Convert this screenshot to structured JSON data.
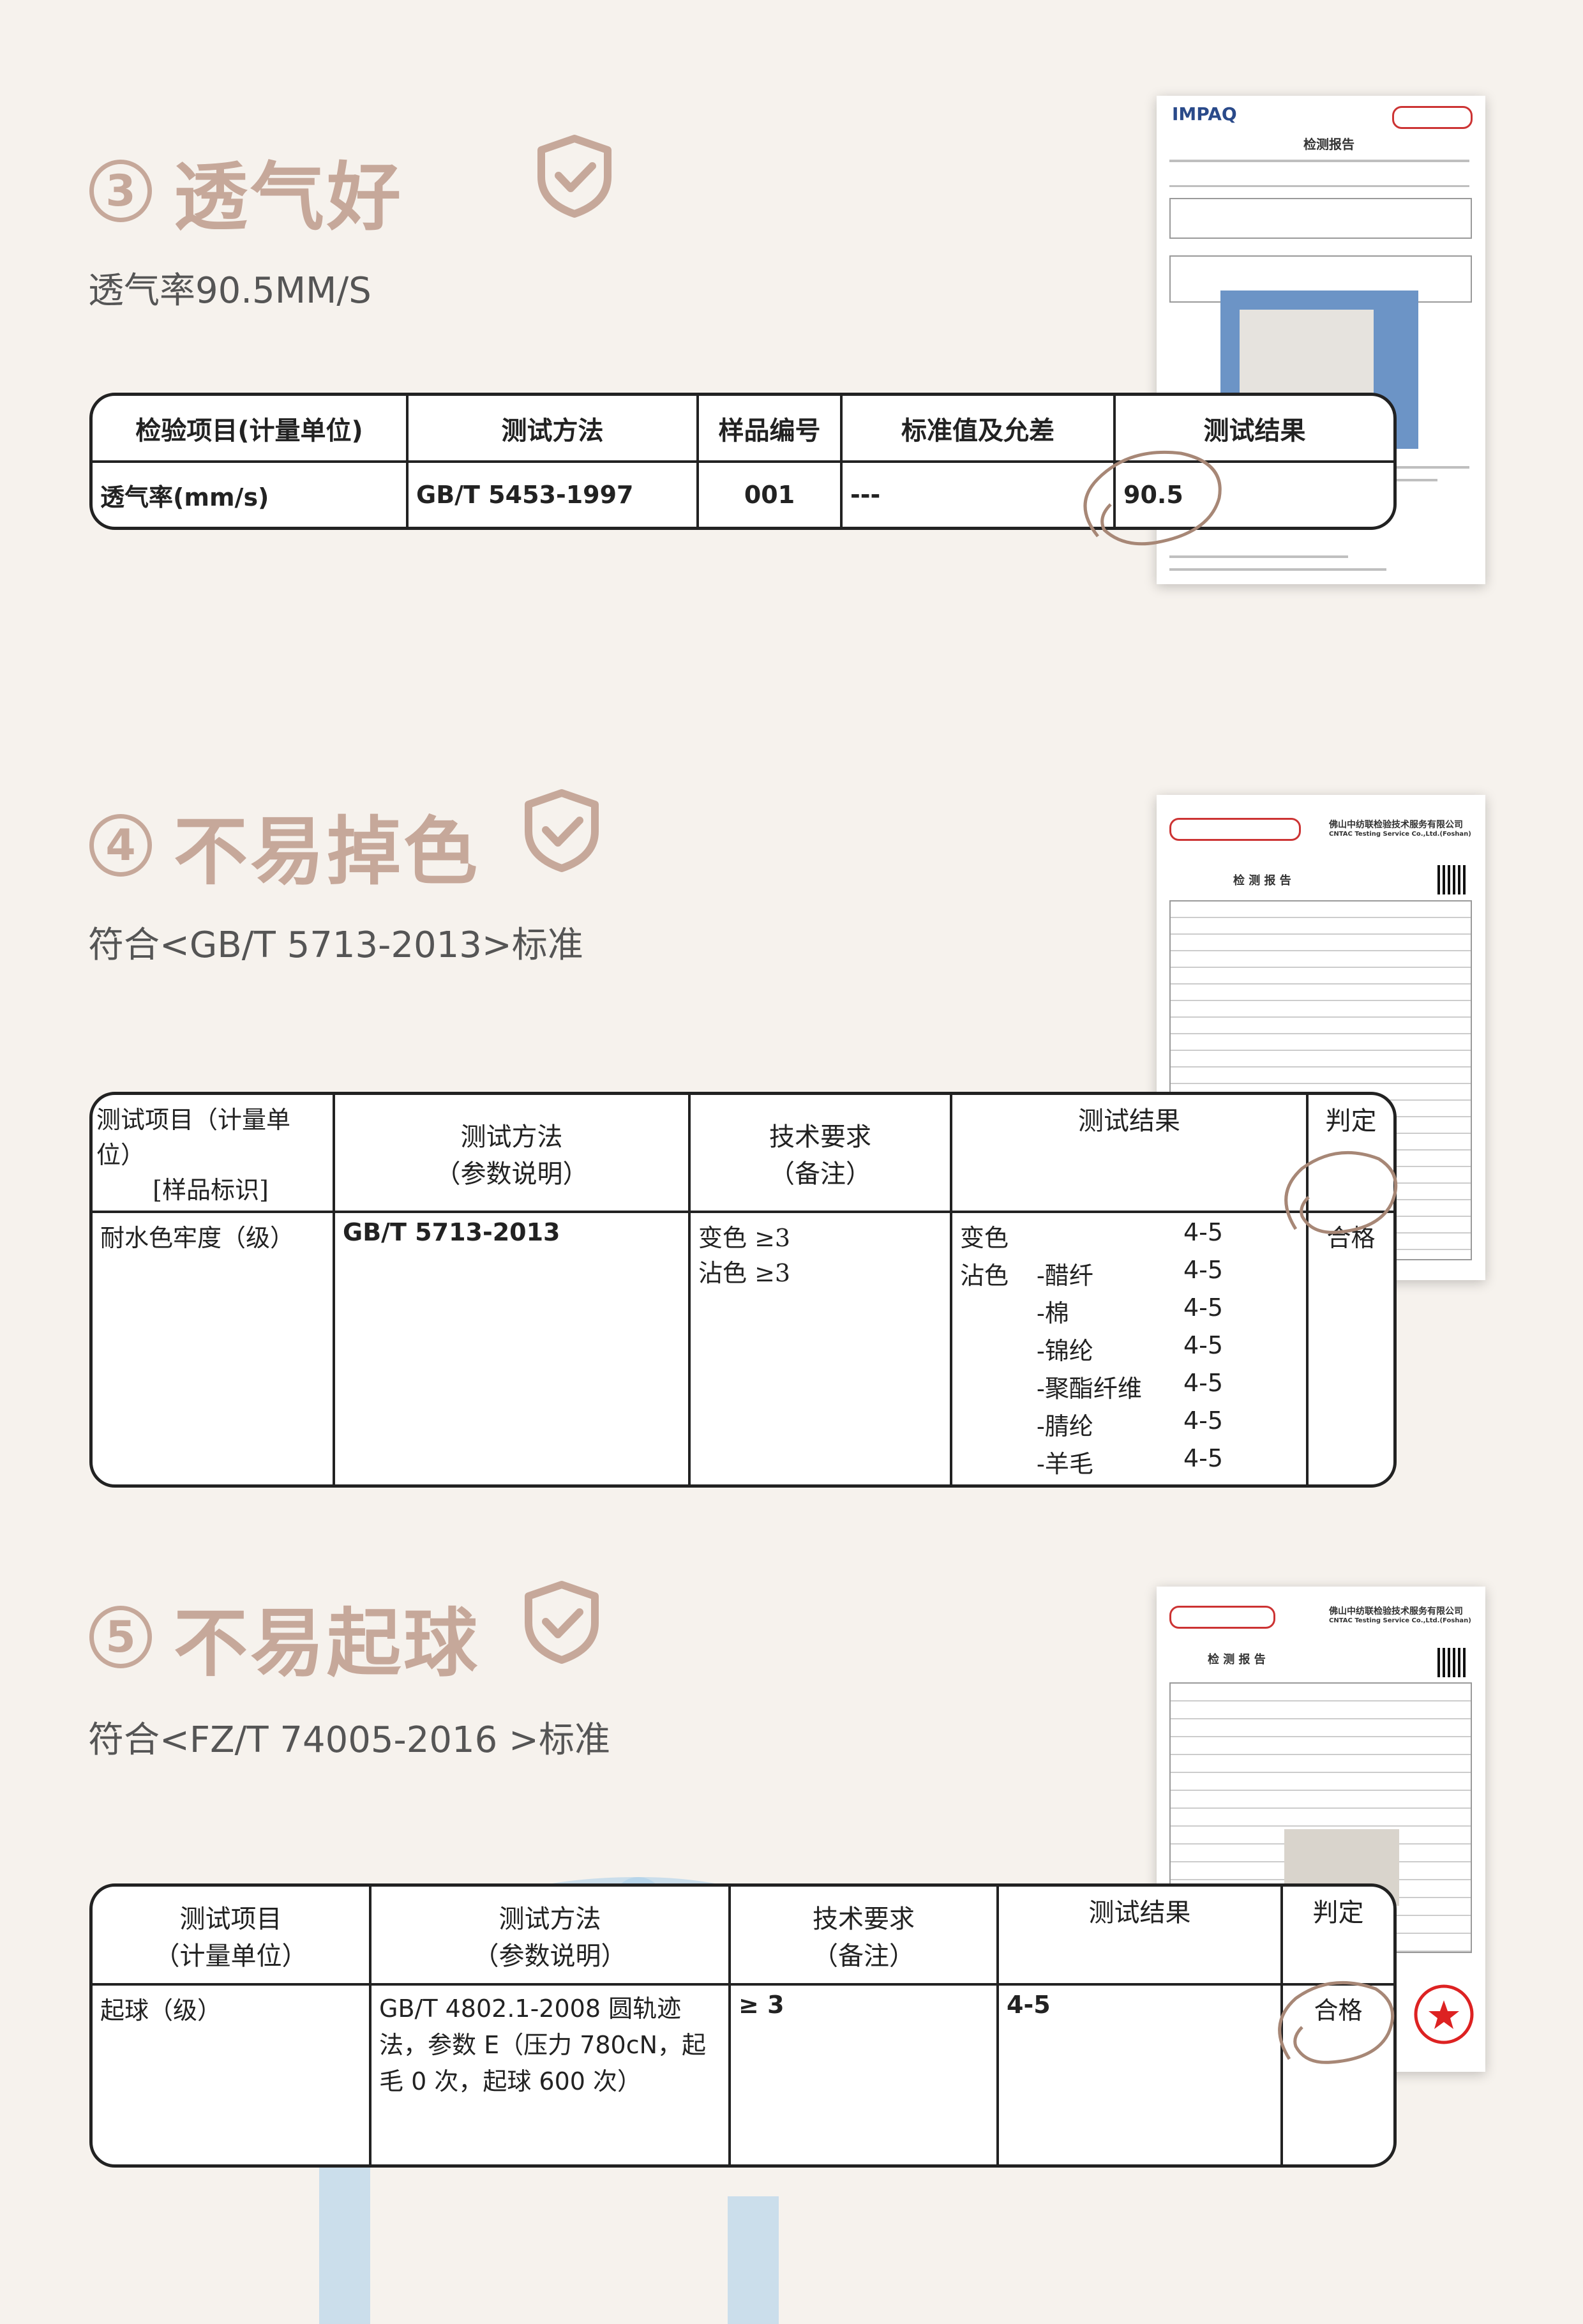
{
  "sections": [
    {
      "num": "3",
      "title": "透气好",
      "subtitle": "透气率90.5MM/S",
      "icon": "shield-check-icon",
      "table": {
        "headers": [
          "检验项目(计量单位)",
          "测试方法",
          "样品编号",
          "标准值及允差",
          "测试结果"
        ],
        "row": [
          "透气率(mm/s)",
          "GB/T 5453-1997",
          "001",
          "---",
          "90.5"
        ]
      },
      "report": {
        "brand": "IMPAQ",
        "title": "检测报告"
      }
    },
    {
      "num": "4",
      "title": "不易掉色",
      "subtitle": "符合<GB/T 5713-2013>标准",
      "icon": "shield-check-icon",
      "table": {
        "headers": [
          "测试项目（计量单位）",
          "[样品标识]",
          "测试方法",
          "（参数说明）",
          "技术要求",
          "（备注）",
          "测试结果",
          "判定"
        ],
        "item": "耐水色牢度（级）",
        "method": "GB/T 5713-2013",
        "req1": "变色 ≥3",
        "req2": "沾色 ≥3",
        "results": [
          {
            "a": "变色",
            "b": "",
            "c": "4-5"
          },
          {
            "a": "沾色",
            "b": "-醋纤",
            "c": "4-5"
          },
          {
            "a": "",
            "b": "-棉",
            "c": "4-5"
          },
          {
            "a": "",
            "b": "-锦纶",
            "c": "4-5"
          },
          {
            "a": "",
            "b": "-聚酯纤维",
            "c": "4-5"
          },
          {
            "a": "",
            "b": "-腈纶",
            "c": "4-5"
          },
          {
            "a": "",
            "b": "-羊毛",
            "c": "4-5"
          }
        ],
        "verdict": "合格"
      },
      "report": {
        "company": "佛山中纺联检验技术服务有限公司",
        "company_en": "CNTAC Testing Service Co.,Ltd.(Foshan)",
        "title": "检 测 报 告"
      }
    },
    {
      "num": "5",
      "title": "不易起球",
      "subtitle": "符合<FZ/T 74005-2016 >标准",
      "icon": "shield-check-icon",
      "table": {
        "headers": [
          "测试项目",
          "（计量单位）",
          "测试方法",
          "（参数说明）",
          "技术要求",
          "（备注）",
          "测试结果",
          "判定"
        ],
        "item": "起球（级）",
        "method": "GB/T 4802.1-2008 圆轨迹法，参数 E（压力 780cN，起毛 0 次，起球 600 次）",
        "req": "≥ 3",
        "result": "4-5",
        "verdict": "合格"
      },
      "report": {
        "company": "佛山中纺联检验技术服务有限公司",
        "company_en": "CNTAC Testing Service Co.,Ltd.(Foshan)",
        "title": "检 测 报 告"
      }
    }
  ],
  "colors": {
    "accent": "#c6a89a",
    "bg": "#f6f2ed",
    "circle": "#a78776"
  }
}
